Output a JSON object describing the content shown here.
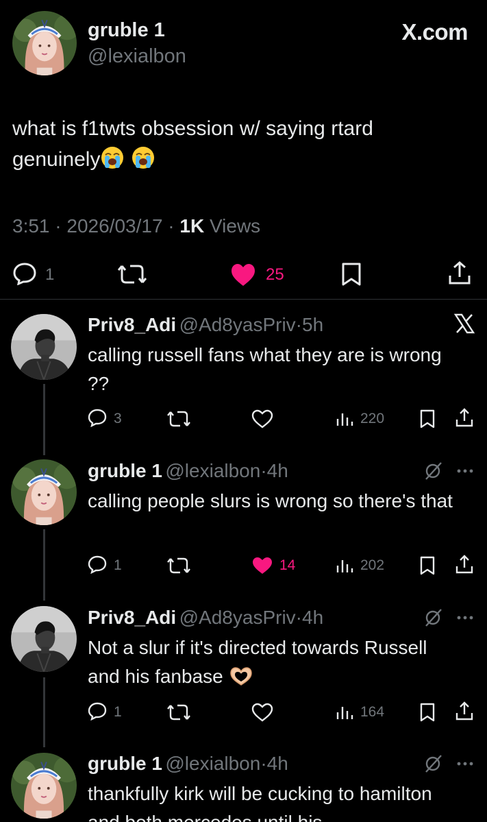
{
  "brand": "X.com",
  "main_tweet": {
    "name": "gruble 1",
    "handle": "@lexialbon",
    "text": "what is f1twts obsession w/ saying rtard genuinely",
    "emojis": [
      "loudly-crying-face",
      "loudly-crying-face"
    ],
    "time": "3:51",
    "date": "2026/03/17",
    "views_count": "1K",
    "views_label": "Views",
    "replies": "1",
    "likes": "25"
  },
  "replies": [
    {
      "name": "Priv8_Adi",
      "handle": "@Ad8yasPriv",
      "time": "5h",
      "text": "calling russell fans what they are is wrong ??",
      "reply_count": "3",
      "like_count": "",
      "views": "220",
      "liked": false,
      "corner_icon": "x-logo"
    },
    {
      "name": "gruble 1",
      "handle": "@lexialbon",
      "time": "4h",
      "text": "calling people slurs is wrong so there's that",
      "reply_count": "1",
      "like_count": "14",
      "views": "202",
      "liked": true,
      "corner_icon": "grok-icon"
    },
    {
      "name": "Priv8_Adi",
      "handle": "@Ad8yasPriv",
      "time": "4h",
      "text": "Not a slur if it's directed towards Russell and his fanbase",
      "emoji": "heart-hands",
      "reply_count": "1",
      "like_count": "",
      "views": "164",
      "liked": false,
      "corner_icon": "grok-icon"
    },
    {
      "name": "gruble 1",
      "handle": "@lexialbon",
      "time": "4h",
      "text": "thankfully kirk will be cucking to hamilton and both mercedes until his",
      "corner_icon": "grok-icon"
    }
  ],
  "colors": {
    "background": "#000000",
    "text": "#e7e9ea",
    "muted": "#71767b",
    "like": "#f91880"
  }
}
